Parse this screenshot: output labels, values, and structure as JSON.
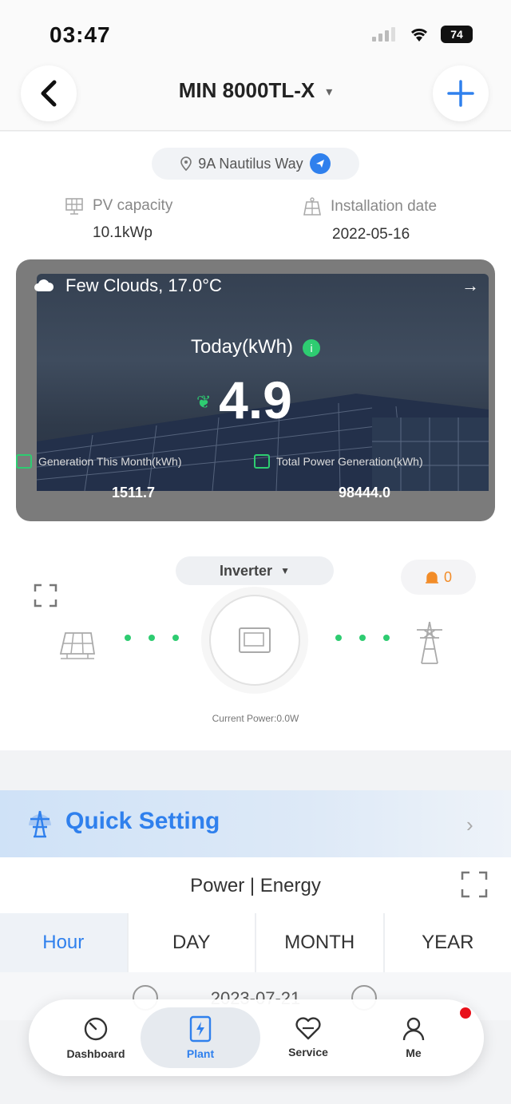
{
  "status_bar": {
    "time": "03:47",
    "battery": "74"
  },
  "header": {
    "title": "MIN 8000TL-X",
    "caret": "▾",
    "add": "+"
  },
  "plant": {
    "address": "9A Nautilus Way",
    "pv_capacity_label": "PV capacity",
    "pv_capacity_value": "10.1kWp",
    "install_label": "Installation date",
    "install_value": "2022-05-16"
  },
  "weather": {
    "text": "Few Clouds,  17.0°C",
    "today_label": "Today(kWh)",
    "today_value": "4.9",
    "month_label": "Generation This Month(kWh)",
    "month_value": "1511.7",
    "total_label": "Total Power Generation(kWh)",
    "total_value": "98444.0"
  },
  "inverter": {
    "selector_label": "Inverter",
    "alarm_count": "0",
    "current_power": "Current Power:0.0W"
  },
  "quick_setting": {
    "label": "Quick Setting"
  },
  "power_energy": {
    "title": "Power | Energy",
    "tabs": [
      "Hour",
      "DAY",
      "MONTH",
      "YEAR"
    ],
    "active_tab": "Hour",
    "date": "2023-07-21"
  },
  "nav": {
    "items": [
      "Dashboard",
      "Plant",
      "Service",
      "Me"
    ],
    "active": "Plant"
  },
  "colors": {
    "accent": "#2f80ed",
    "green": "#2ecc71",
    "alarm": "#f28c28"
  }
}
